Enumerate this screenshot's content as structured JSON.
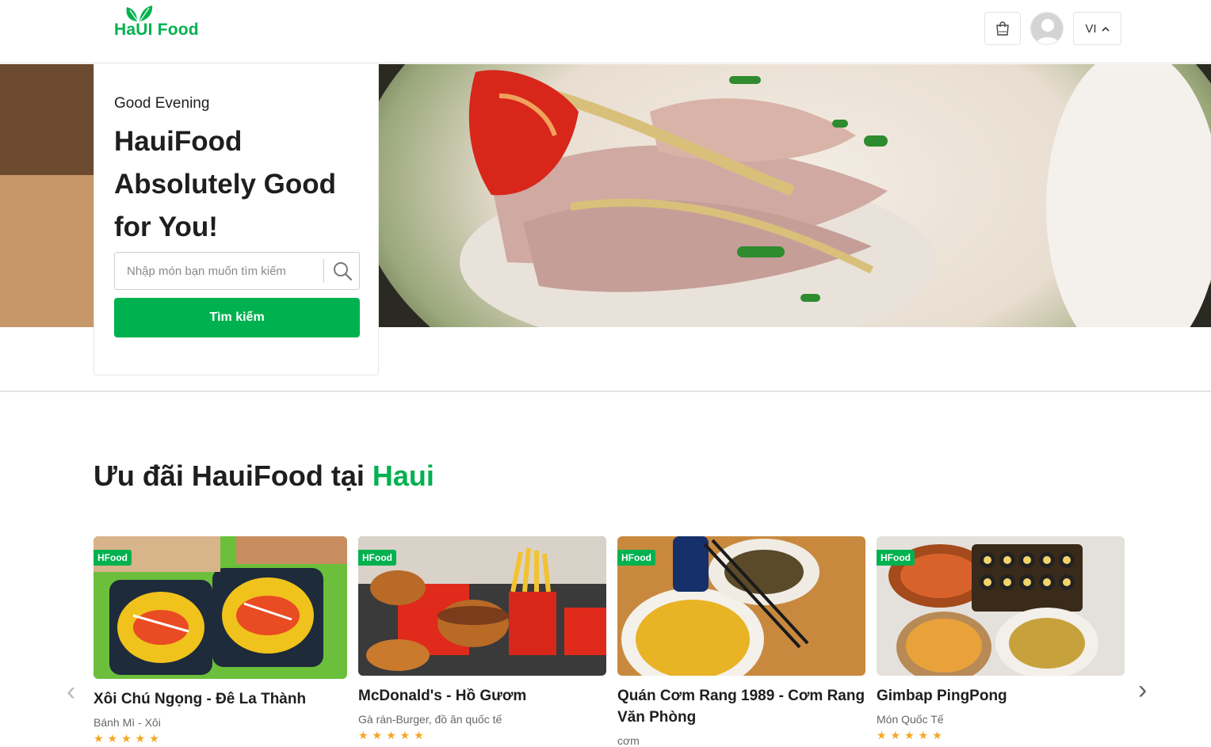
{
  "header": {
    "logo_text": "HaUI Food",
    "lang_label": "VI",
    "icons": {
      "cart": "shopping-bag-icon",
      "avatar": "user-avatar-icon",
      "lang_toggle": "chevron-up-icon"
    }
  },
  "hero": {
    "greeting": "Good Evening",
    "title": "HauiFood Absolutely Good for You!",
    "search_placeholder": "Nhập món bạn muốn tìm kiếm",
    "search_button": "Tìm kiếm"
  },
  "section": {
    "title_prefix": "Ưu đãi HauiFood tại ",
    "title_accent": "Haui"
  },
  "restaurants": [
    {
      "badge": "HFood",
      "name": "Xôi Chú Ngọng - Đê La Thành",
      "category": "Bánh Mì - Xôi"
    },
    {
      "badge": "HFood",
      "name": "McDonald's - Hồ Gươm",
      "category": "Gà rán-Burger, đồ ăn quốc tế"
    },
    {
      "badge": "HFood",
      "name": "Quán Cơm Rang 1989 - Cơm Rang Văn Phòng",
      "category": "cơm"
    },
    {
      "badge": "HFood",
      "name": "Gimbap PingPong",
      "category": "Món Quốc Tế"
    }
  ],
  "colors": {
    "brand": "#00b14f",
    "text": "#1e1e1e",
    "muted": "#676767"
  }
}
